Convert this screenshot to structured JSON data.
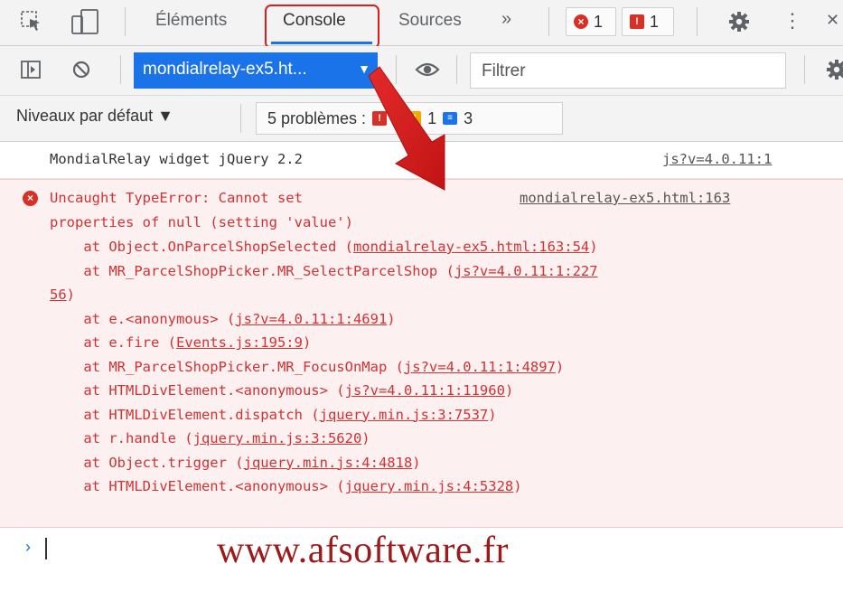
{
  "tabs": {
    "elements": "Éléments",
    "console": "Console",
    "sources": "Sources",
    "more": "»",
    "error_count": "1",
    "issue_count": "1",
    "more_icon": "⋮",
    "close_icon": "✕"
  },
  "toolbar": {
    "context": "mondialrelay-ex5.ht...",
    "filter_placeholder": "Filtrer"
  },
  "levels": {
    "default_levels": "Niveaux par défaut ▼",
    "problems_label": "5 problèmes :",
    "problem_errors": "1",
    "problem_warnings": "1",
    "problem_info": "3"
  },
  "console": {
    "log": {
      "text": "MondialRelay widget jQuery 2.2",
      "source": "js?v=4.0.11:1"
    },
    "error": {
      "message_line1": "Uncaught TypeError: Cannot set",
      "message_line2": "properties of null (setting 'value')",
      "source": "mondialrelay-ex5.html:163",
      "stack": [
        {
          "pre": "    at Object.OnParcelShopSelected (",
          "link": "mondialrelay-ex5.html:163:54",
          "post": ")"
        },
        {
          "pre": "    at MR_ParcelShopPicker.MR_SelectParcelShop (",
          "link": "js?v=4.0.11:1:227",
          "post": ""
        },
        {
          "pre": "",
          "link": "56",
          "post": ")"
        },
        {
          "pre": "    at e.<anonymous> (",
          "link": "js?v=4.0.11:1:4691",
          "post": ")"
        },
        {
          "pre": "    at e.fire (",
          "link": "Events.js:195:9",
          "post": ")"
        },
        {
          "pre": "    at MR_ParcelShopPicker.MR_FocusOnMap (",
          "link": "js?v=4.0.11:1:4897",
          "post": ")"
        },
        {
          "pre": "    at HTMLDivElement.<anonymous> (",
          "link": "js?v=4.0.11:1:11960",
          "post": ")"
        },
        {
          "pre": "    at HTMLDivElement.dispatch (",
          "link": "jquery.min.js:3:7537",
          "post": ")"
        },
        {
          "pre": "    at r.handle (",
          "link": "jquery.min.js:3:5620",
          "post": ")"
        },
        {
          "pre": "    at Object.trigger (",
          "link": "jquery.min.js:4:4818",
          "post": ")"
        },
        {
          "pre": "    at HTMLDivElement.<anonymous> (",
          "link": "jquery.min.js:4:5328",
          "post": ")"
        }
      ]
    },
    "prompt_symbol": "›"
  },
  "watermark": "www.afsoftware.fr",
  "colors": {
    "accent": "#1a73e8",
    "error": "#d23232",
    "highlight": "#d81e1e"
  }
}
